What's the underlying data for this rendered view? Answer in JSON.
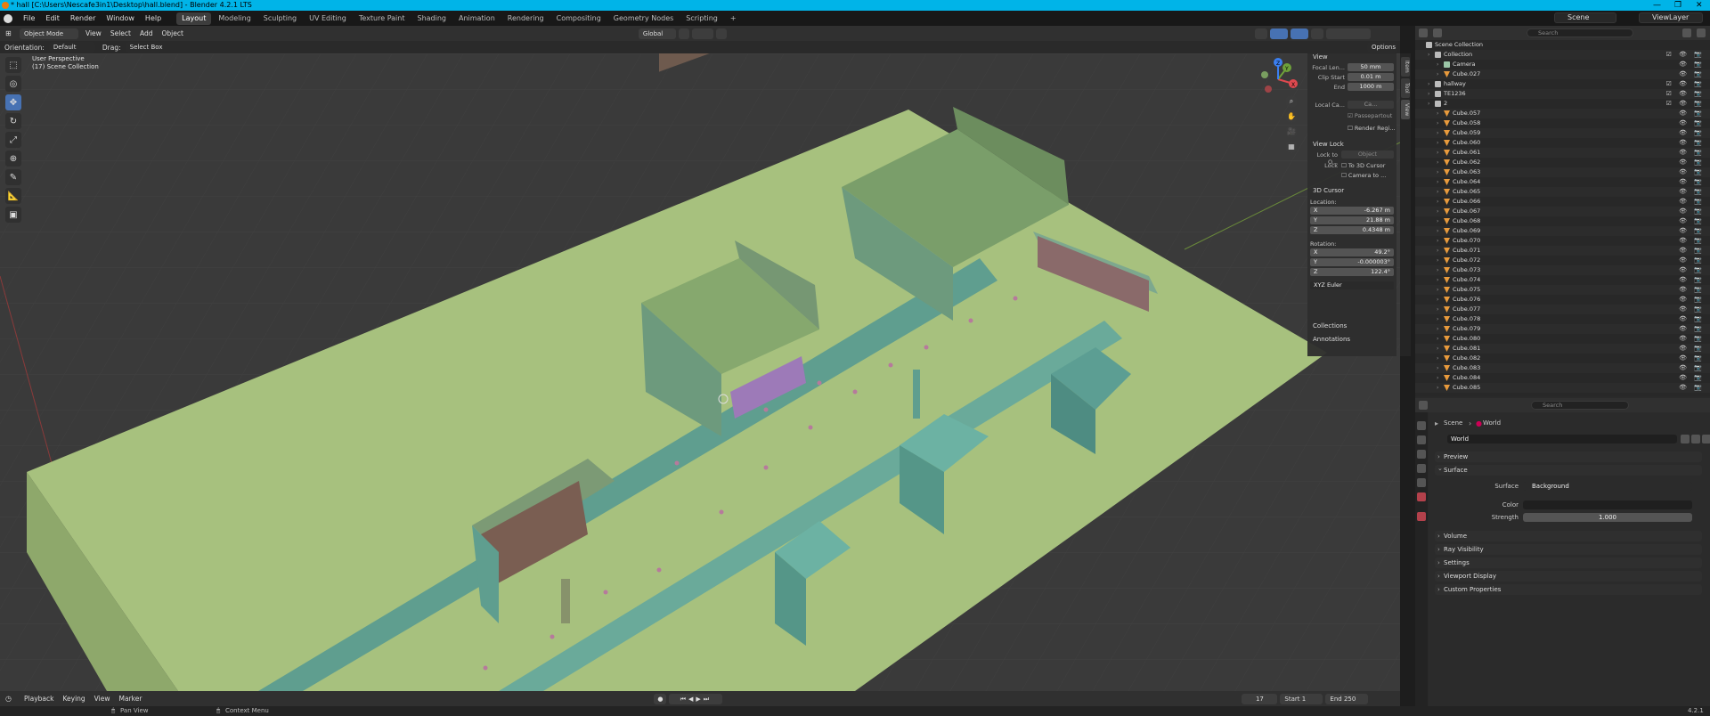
{
  "window": {
    "title": "* hall [C:\\Users\\Nescafe3in1\\Desktop\\hall.blend] - Blender 4.2.1 LTS",
    "controls": [
      "—",
      "❐",
      "✕"
    ]
  },
  "menubar": {
    "menus": [
      "File",
      "Edit",
      "Render",
      "Window",
      "Help"
    ],
    "workspaces": [
      "Layout",
      "Modeling",
      "Sculpting",
      "UV Editing",
      "Texture Paint",
      "Shading",
      "Animation",
      "Rendering",
      "Compositing",
      "Geometry Nodes",
      "Scripting"
    ],
    "active_workspace": "Layout",
    "add_tab": "+",
    "scene": "Scene",
    "view_layer": "ViewLayer"
  },
  "viewport_header": {
    "mode": "Object Mode",
    "menus": [
      "View",
      "Select",
      "Add",
      "Object"
    ],
    "transform_orientation": "Global",
    "options": "Options"
  },
  "tool_header": {
    "orientation_label": "Orientation:",
    "orientation_value": "Default",
    "drag_label": "Drag:",
    "drag_value": "Select Box"
  },
  "viewport": {
    "perspective": "User Perspective",
    "collection_info": "(17) Scene Collection",
    "gizmo": {
      "x_label": "X",
      "y_label": "Y",
      "z_label": "Z"
    }
  },
  "npanel": {
    "view_section": "View",
    "focal_length_label": "Focal Len...",
    "focal_length_value": "50 mm",
    "clip_start_label": "Clip Start",
    "clip_start_value": "0.01 m",
    "end_label": "End",
    "end_value": "1000 m",
    "local_camera_label": "Local Ca...",
    "local_camera_value": "Ca...",
    "passepartout": "Passepartout",
    "render_region": "Render Regi...",
    "view_lock_section": "View Lock",
    "lock_to_object_label": "Lock to O...",
    "lock_to_object_value": "Object",
    "lock_label": "Lock",
    "to_3d_cursor": "To 3D Cursor",
    "camera_to_view": "Camera to ...",
    "cursor_section": "3D Cursor",
    "location_label": "Location:",
    "loc_x_label": "X",
    "loc_x": "-6.267 m",
    "loc_y_label": "Y",
    "loc_y": "21.88 m",
    "loc_z_label": "Z",
    "loc_z": "0.4348 m",
    "rotation_label": "Rotation:",
    "rot_x_label": "X",
    "rot_x": "49.2°",
    "rot_y_label": "Y",
    "rot_y": "-0.000003°",
    "rot_z_label": "Z",
    "rot_z": "122.4°",
    "rotation_mode": "XYZ Euler",
    "collections_section": "Collections",
    "annotations_section": "Annotations",
    "tabs": [
      "Item",
      "Tool",
      "View"
    ]
  },
  "timeline": {
    "menus": [
      "Playback",
      "Keying",
      "View",
      "Marker"
    ],
    "current_frame": "17",
    "start_label": "Start",
    "start_value": "1",
    "end_label": "End",
    "end_value": "250"
  },
  "statusbar": {
    "pan_view": "Pan View",
    "context_menu": "Context Menu",
    "version": "4.2.1"
  },
  "outliner": {
    "search_placeholder": "Search",
    "rows": [
      {
        "name": "Scene Collection",
        "depth": 0,
        "icon": "coll",
        "vis": ""
      },
      {
        "name": "Collection",
        "depth": 1,
        "icon": "coll",
        "vis": "☑ 👁 📷"
      },
      {
        "name": "Camera",
        "depth": 2,
        "icon": "camera",
        "vis": "👁 📷"
      },
      {
        "name": "Cube.027",
        "depth": 2,
        "icon": "mesh",
        "vis": "👁 📷"
      },
      {
        "name": "hallway",
        "depth": 1,
        "icon": "coll",
        "vis": "☑ 👁 📷"
      },
      {
        "name": "TE1236",
        "depth": 1,
        "icon": "coll",
        "vis": "☑ 👁 📷"
      },
      {
        "name": "2",
        "depth": 1,
        "icon": "coll",
        "vis": "☑ 👁 📷"
      },
      {
        "name": "Cube.057",
        "depth": 2,
        "icon": "mesh",
        "vis": "👁 📷"
      },
      {
        "name": "Cube.058",
        "depth": 2,
        "icon": "mesh",
        "vis": "👁 📷"
      },
      {
        "name": "Cube.059",
        "depth": 2,
        "icon": "mesh",
        "vis": "👁 📷"
      },
      {
        "name": "Cube.060",
        "depth": 2,
        "icon": "mesh",
        "vis": "👁 📷"
      },
      {
        "name": "Cube.061",
        "depth": 2,
        "icon": "mesh",
        "vis": "👁 📷"
      },
      {
        "name": "Cube.062",
        "depth": 2,
        "icon": "mesh",
        "vis": "👁 📷"
      },
      {
        "name": "Cube.063",
        "depth": 2,
        "icon": "mesh",
        "vis": "👁 📷"
      },
      {
        "name": "Cube.064",
        "depth": 2,
        "icon": "mesh",
        "vis": "👁 📷"
      },
      {
        "name": "Cube.065",
        "depth": 2,
        "icon": "mesh",
        "vis": "👁 📷"
      },
      {
        "name": "Cube.066",
        "depth": 2,
        "icon": "mesh",
        "vis": "👁 📷"
      },
      {
        "name": "Cube.067",
        "depth": 2,
        "icon": "mesh",
        "vis": "👁 📷"
      },
      {
        "name": "Cube.068",
        "depth": 2,
        "icon": "mesh",
        "vis": "👁 📷"
      },
      {
        "name": "Cube.069",
        "depth": 2,
        "icon": "mesh",
        "vis": "👁 📷"
      },
      {
        "name": "Cube.070",
        "depth": 2,
        "icon": "mesh",
        "vis": "👁 📷"
      },
      {
        "name": "Cube.071",
        "depth": 2,
        "icon": "mesh",
        "vis": "👁 📷"
      },
      {
        "name": "Cube.072",
        "depth": 2,
        "icon": "mesh",
        "vis": "👁 📷"
      },
      {
        "name": "Cube.073",
        "depth": 2,
        "icon": "mesh",
        "vis": "👁 📷"
      },
      {
        "name": "Cube.074",
        "depth": 2,
        "icon": "mesh",
        "vis": "👁 📷"
      },
      {
        "name": "Cube.075",
        "depth": 2,
        "icon": "mesh",
        "vis": "👁 📷"
      },
      {
        "name": "Cube.076",
        "depth": 2,
        "icon": "mesh",
        "vis": "👁 📷"
      },
      {
        "name": "Cube.077",
        "depth": 2,
        "icon": "mesh",
        "vis": "👁 📷"
      },
      {
        "name": "Cube.078",
        "depth": 2,
        "icon": "mesh",
        "vis": "👁 📷"
      },
      {
        "name": "Cube.079",
        "depth": 2,
        "icon": "mesh",
        "vis": "👁 📷"
      },
      {
        "name": "Cube.080",
        "depth": 2,
        "icon": "mesh",
        "vis": "👁 📷"
      },
      {
        "name": "Cube.081",
        "depth": 2,
        "icon": "mesh",
        "vis": "👁 📷"
      },
      {
        "name": "Cube.082",
        "depth": 2,
        "icon": "mesh",
        "vis": "👁 📷"
      },
      {
        "name": "Cube.083",
        "depth": 2,
        "icon": "mesh",
        "vis": "👁 📷"
      },
      {
        "name": "Cube.084",
        "depth": 2,
        "icon": "mesh",
        "vis": "👁 📷"
      },
      {
        "name": "Cube.085",
        "depth": 2,
        "icon": "mesh",
        "vis": "👁 📷"
      }
    ]
  },
  "properties": {
    "search_placeholder": "Search",
    "breadcrumb_scene": "Scene",
    "breadcrumb_world": "World",
    "world_name": "World",
    "panels": [
      "Preview",
      "Surface",
      "Volume",
      "Ray Visibility",
      "Settings",
      "Viewport Display",
      "Custom Properties"
    ],
    "surface_label": "Surface",
    "surface_value": "Background",
    "color_label": "Color",
    "strength_label": "Strength",
    "strength_value": "1.000"
  },
  "colors": {
    "accent": "#4772b3",
    "titlebar": "#00b4e8",
    "floor": "#a7c17e",
    "walls": "#5f9e8f",
    "grid_bg": "#3a3a3a"
  }
}
